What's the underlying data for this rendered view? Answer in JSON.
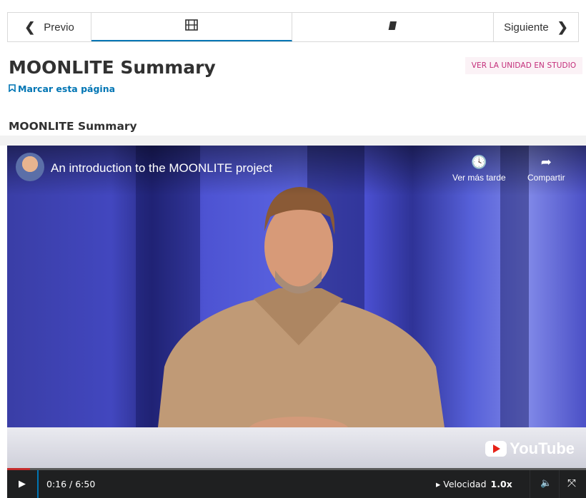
{
  "nav": {
    "prev_label": "Previo",
    "next_label": "Siguiente",
    "tab_video_icon": "film-icon",
    "tab_problem_icon": "book-icon"
  },
  "page": {
    "title": "MOONLITE Summary",
    "studio_button": "VER LA UNIDAD EN STUDIO",
    "bookmark_label": "Marcar esta página",
    "unit_title": "MOONLITE Summary"
  },
  "video": {
    "title": "An introduction to the MOONLITE project",
    "watch_later": "Ver más tarde",
    "share": "Compartir",
    "brand": "YouTube",
    "time": "0:16 / 6:50",
    "progress_fraction": 0.039,
    "speed_label": "Velocidad",
    "speed_value": "1.0x"
  },
  "colors": {
    "accent": "#0075b4",
    "studio_text": "#c32d7a",
    "studio_bg": "#fbf2f6",
    "progress": "#c42c2c"
  }
}
